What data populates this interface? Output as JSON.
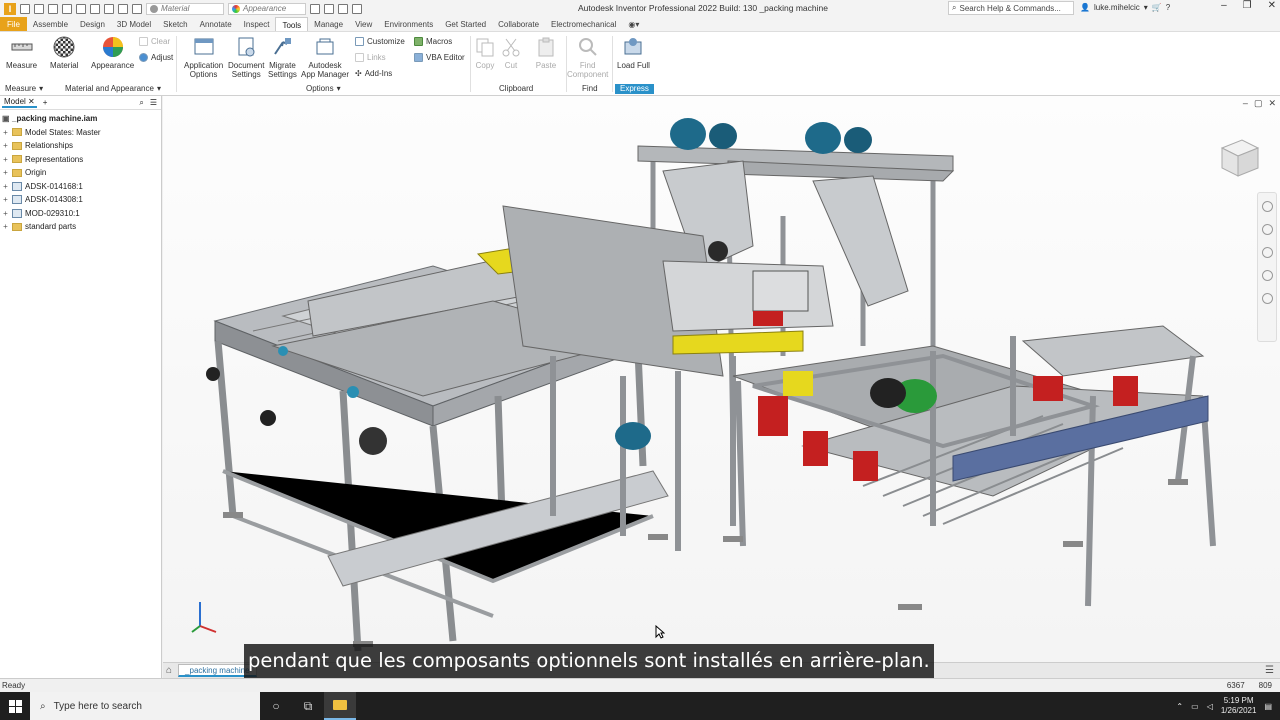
{
  "window": {
    "title": "Autodesk Inventor Professional 2022 Build: 130   _packing machine",
    "search_placeholder": "Search Help & Commands...",
    "user": "luke.mihelcic",
    "material_combo": "Material",
    "appearance_combo": "Appearance"
  },
  "tabs": [
    "File",
    "Assemble",
    "Design",
    "3D Model",
    "Sketch",
    "Annotate",
    "Inspect",
    "Tools",
    "Manage",
    "View",
    "Environments",
    "Get Started",
    "Collaborate",
    "Electromechanical"
  ],
  "ribbon": {
    "measure": "Measure",
    "material": "Material",
    "appearance": "Appearance",
    "clear": "Clear",
    "adjust": "Adjust",
    "app_options": [
      "Application",
      "Options"
    ],
    "doc_settings": [
      "Document",
      "Settings"
    ],
    "migrate_settings": [
      "Migrate",
      "Settings"
    ],
    "app_manager": [
      "Autodesk",
      "App Manager"
    ],
    "customize": "Customize",
    "links": "Links",
    "addins": "Add-Ins",
    "macros": "Macros",
    "vba_editor": "VBA Editor",
    "copy": "Copy",
    "cut": "Cut",
    "paste": "Paste",
    "find_component": [
      "Find",
      "Component"
    ],
    "load_full": "Load Full",
    "groups": {
      "measure": "Measure",
      "material_appearance": "Material and Appearance",
      "options": "Options",
      "clipboard": "Clipboard",
      "find": "Find",
      "express": "Express"
    }
  },
  "browser": {
    "tab": "Model",
    "items": [
      {
        "label": "_packing machine.iam",
        "kind": "root"
      },
      {
        "label": "Model States: Master",
        "kind": "folder"
      },
      {
        "label": "Relationships",
        "kind": "folder"
      },
      {
        "label": "Representations",
        "kind": "folder"
      },
      {
        "label": "Origin",
        "kind": "folder"
      },
      {
        "label": "ADSK-014168:1",
        "kind": "asm"
      },
      {
        "label": "ADSK-014308:1",
        "kind": "asm"
      },
      {
        "label": "MOD-029310:1",
        "kind": "asm"
      },
      {
        "label": "standard parts",
        "kind": "folder"
      }
    ]
  },
  "doc_tab": "_packing machine",
  "status": {
    "text": "Ready",
    "count1": "6367",
    "count2": "809"
  },
  "taskbar": {
    "search_placeholder": "Type here to search",
    "time": "5:19 PM",
    "date": "1/26/2021"
  },
  "subtitle": "pendant que les composants optionnels sont installés en arrière-plan.",
  "colors": {
    "accent": "#2a91c9",
    "file_tab": "#e8a21a",
    "frame": "#9a9ea3",
    "yellow_part": "#e6d81e",
    "motor_blue": "#1e6a8a",
    "red_part": "#c42020",
    "green_part": "#2a9a3a"
  }
}
